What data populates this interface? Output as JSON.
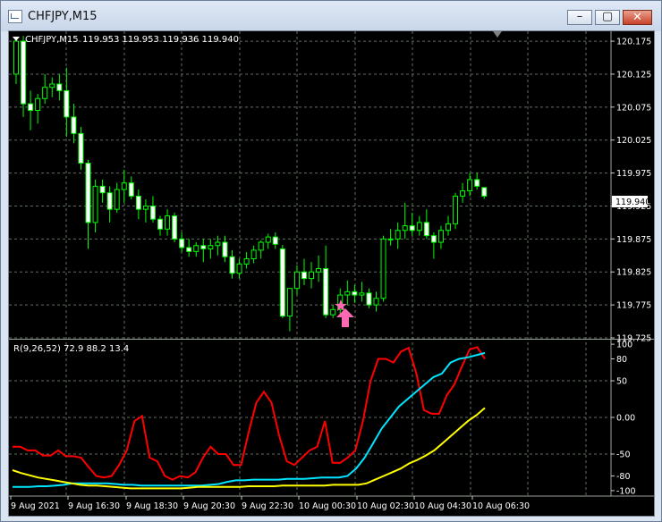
{
  "window": {
    "title": "CHFJPY,M15",
    "minimize_label": "–",
    "maximize_label": "▢",
    "close_label": "✕"
  },
  "main_chart": {
    "label": "CHFJPY,M15",
    "ohlc": "119.953 119.953 119.936 119.940",
    "price_levels": [
      "120.175",
      "120.125",
      "120.075",
      "120.025",
      "119.975",
      "119.925",
      "119.875",
      "119.825",
      "119.775",
      "119.725"
    ],
    "current_price": "119.940"
  },
  "indicator": {
    "label": "R(9,26,52) 72.9 88.2 13.4",
    "levels": [
      "100",
      "80",
      "50",
      "0.00",
      "-50",
      "-80",
      "-100"
    ]
  },
  "time_axis": [
    "9 Aug 2021",
    "9 Aug 16:30",
    "9 Aug 18:30",
    "9 Aug 20:30",
    "9 Aug 22:30",
    "10 Aug 00:30",
    "10 Aug 02:30",
    "10 Aug 04:30",
    "10 Aug 06:30"
  ],
  "colors": {
    "background": "#000000",
    "grid": "#5f6f5f",
    "candle": "#00ff00",
    "fast_line": "#ff0000",
    "mid_line": "#00e5ff",
    "slow_line": "#ffff00",
    "arrow": "#ff69b4"
  },
  "chart_data": [
    {
      "type": "candlestick",
      "title": "CHFJPY,M15",
      "ylim": [
        119.725,
        120.19
      ],
      "values": [
        {
          "o": 120.125,
          "h": 120.178,
          "l": 120.11,
          "c": 120.175
        },
        {
          "o": 120.175,
          "h": 120.183,
          "l": 120.06,
          "c": 120.08
        },
        {
          "o": 120.08,
          "h": 120.1,
          "l": 120.04,
          "c": 120.07
        },
        {
          "o": 120.07,
          "h": 120.095,
          "l": 120.05,
          "c": 120.088
        },
        {
          "o": 120.088,
          "h": 120.125,
          "l": 120.08,
          "c": 120.105
        },
        {
          "o": 120.105,
          "h": 120.12,
          "l": 120.09,
          "c": 120.11
        },
        {
          "o": 120.11,
          "h": 120.125,
          "l": 120.085,
          "c": 120.1
        },
        {
          "o": 120.1,
          "h": 120.135,
          "l": 120.03,
          "c": 120.06
        },
        {
          "o": 120.06,
          "h": 120.08,
          "l": 120.02,
          "c": 120.035
        },
        {
          "o": 120.035,
          "h": 120.045,
          "l": 119.98,
          "c": 119.99
        },
        {
          "o": 119.99,
          "h": 119.995,
          "l": 119.86,
          "c": 119.9
        },
        {
          "o": 119.9,
          "h": 119.965,
          "l": 119.885,
          "c": 119.955
        },
        {
          "o": 119.955,
          "h": 119.965,
          "l": 119.93,
          "c": 119.945
        },
        {
          "o": 119.945,
          "h": 119.955,
          "l": 119.9,
          "c": 119.92
        },
        {
          "o": 119.92,
          "h": 119.96,
          "l": 119.915,
          "c": 119.95
        },
        {
          "o": 119.95,
          "h": 119.98,
          "l": 119.93,
          "c": 119.96
        },
        {
          "o": 119.96,
          "h": 119.97,
          "l": 119.935,
          "c": 119.94
        },
        {
          "o": 119.94,
          "h": 119.95,
          "l": 119.905,
          "c": 119.92
        },
        {
          "o": 119.92,
          "h": 119.935,
          "l": 119.9,
          "c": 119.925
        },
        {
          "o": 119.925,
          "h": 119.94,
          "l": 119.9,
          "c": 119.905
        },
        {
          "o": 119.905,
          "h": 119.91,
          "l": 119.88,
          "c": 119.89
        },
        {
          "o": 119.89,
          "h": 119.92,
          "l": 119.88,
          "c": 119.91
        },
        {
          "o": 119.91,
          "h": 119.915,
          "l": 119.87,
          "c": 119.875
        },
        {
          "o": 119.875,
          "h": 119.885,
          "l": 119.855,
          "c": 119.862
        },
        {
          "o": 119.862,
          "h": 119.875,
          "l": 119.848,
          "c": 119.856
        },
        {
          "o": 119.856,
          "h": 119.87,
          "l": 119.848,
          "c": 119.865
        },
        {
          "o": 119.865,
          "h": 119.875,
          "l": 119.84,
          "c": 119.86
        },
        {
          "o": 119.86,
          "h": 119.875,
          "l": 119.845,
          "c": 119.865
        },
        {
          "o": 119.865,
          "h": 119.88,
          "l": 119.85,
          "c": 119.87
        },
        {
          "o": 119.87,
          "h": 119.88,
          "l": 119.84,
          "c": 119.848
        },
        {
          "o": 119.848,
          "h": 119.858,
          "l": 119.815,
          "c": 119.823
        },
        {
          "o": 119.823,
          "h": 119.845,
          "l": 119.815,
          "c": 119.837
        },
        {
          "o": 119.837,
          "h": 119.855,
          "l": 119.83,
          "c": 119.845
        },
        {
          "o": 119.845,
          "h": 119.865,
          "l": 119.838,
          "c": 119.858
        },
        {
          "o": 119.858,
          "h": 119.873,
          "l": 119.845,
          "c": 119.87
        },
        {
          "o": 119.87,
          "h": 119.883,
          "l": 119.86,
          "c": 119.878
        },
        {
          "o": 119.878,
          "h": 119.885,
          "l": 119.86,
          "c": 119.867
        },
        {
          "o": 119.86,
          "h": 119.866,
          "l": 119.755,
          "c": 119.758
        },
        {
          "o": 119.758,
          "h": 119.8,
          "l": 119.735,
          "c": 119.8
        },
        {
          "o": 119.8,
          "h": 119.835,
          "l": 119.79,
          "c": 119.825
        },
        {
          "o": 119.825,
          "h": 119.845,
          "l": 119.805,
          "c": 119.815
        },
        {
          "o": 119.815,
          "h": 119.84,
          "l": 119.8,
          "c": 119.825
        },
        {
          "o": 119.825,
          "h": 119.85,
          "l": 119.81,
          "c": 119.83
        },
        {
          "o": 119.83,
          "h": 119.865,
          "l": 119.755,
          "c": 119.76
        },
        {
          "o": 119.76,
          "h": 119.775,
          "l": 119.755,
          "c": 119.768
        },
        {
          "o": 119.768,
          "h": 119.8,
          "l": 119.76,
          "c": 119.79
        },
        {
          "o": 119.79,
          "h": 119.812,
          "l": 119.775,
          "c": 119.795
        },
        {
          "o": 119.795,
          "h": 119.805,
          "l": 119.778,
          "c": 119.79
        },
        {
          "o": 119.79,
          "h": 119.81,
          "l": 119.78,
          "c": 119.793
        },
        {
          "o": 119.793,
          "h": 119.8,
          "l": 119.77,
          "c": 119.775
        },
        {
          "o": 119.775,
          "h": 119.795,
          "l": 119.765,
          "c": 119.785
        },
        {
          "o": 119.785,
          "h": 119.88,
          "l": 119.78,
          "c": 119.875
        },
        {
          "o": 119.875,
          "h": 119.89,
          "l": 119.865,
          "c": 119.875
        },
        {
          "o": 119.875,
          "h": 119.9,
          "l": 119.86,
          "c": 119.888
        },
        {
          "o": 119.888,
          "h": 119.93,
          "l": 119.875,
          "c": 119.895
        },
        {
          "o": 119.895,
          "h": 119.915,
          "l": 119.88,
          "c": 119.888
        },
        {
          "o": 119.888,
          "h": 119.91,
          "l": 119.88,
          "c": 119.9
        },
        {
          "o": 119.9,
          "h": 119.92,
          "l": 119.875,
          "c": 119.88
        },
        {
          "o": 119.88,
          "h": 119.885,
          "l": 119.845,
          "c": 119.87
        },
        {
          "o": 119.87,
          "h": 119.895,
          "l": 119.86,
          "c": 119.888
        },
        {
          "o": 119.888,
          "h": 119.91,
          "l": 119.88,
          "c": 119.898
        },
        {
          "o": 119.898,
          "h": 119.945,
          "l": 119.89,
          "c": 119.94
        },
        {
          "o": 119.94,
          "h": 119.96,
          "l": 119.93,
          "c": 119.948
        },
        {
          "o": 119.948,
          "h": 119.975,
          "l": 119.94,
          "c": 119.965
        },
        {
          "o": 119.965,
          "h": 119.975,
          "l": 119.95,
          "c": 119.955
        },
        {
          "o": 119.953,
          "h": 119.953,
          "l": 119.936,
          "c": 119.94
        }
      ]
    },
    {
      "type": "line",
      "title": "R(9,26,52)",
      "ylim": [
        -105,
        105
      ],
      "series": [
        {
          "name": "R(9)",
          "values": [
            -40,
            -40,
            -45,
            -45,
            -52,
            -52,
            -45,
            -53,
            -53,
            -55,
            -68,
            -80,
            -82,
            -80,
            -65,
            -45,
            -5,
            2,
            -55,
            -60,
            -80,
            -85,
            -80,
            -82,
            -75,
            -55,
            -40,
            -50,
            -50,
            -65,
            -65,
            -20,
            20,
            35,
            20,
            -25,
            -60,
            -65,
            -55,
            -45,
            -40,
            -5,
            -62,
            -62,
            -55,
            -45,
            -5,
            50,
            80,
            80,
            75,
            90,
            95,
            60,
            10,
            5,
            5,
            30,
            45,
            70,
            93,
            96,
            80
          ]
        },
        {
          "name": "R(26)",
          "values": [
            -95,
            -95,
            -95,
            -94,
            -94,
            -93,
            -92,
            -90,
            -90,
            -90,
            -90,
            -90,
            -91,
            -92,
            -92,
            -93,
            -93,
            -93,
            -93,
            -93,
            -93,
            -93,
            -93,
            -92,
            -91,
            -88,
            -86,
            -86,
            -85,
            -85,
            -85,
            -85,
            -84,
            -84,
            -84,
            -83,
            -82,
            -82,
            -82,
            -80,
            -70,
            -55,
            -35,
            -15,
            0,
            15,
            25,
            35,
            45,
            55,
            60,
            75,
            80,
            82,
            85,
            88
          ]
        },
        {
          "name": "R(52)",
          "values": [
            -72,
            -76,
            -79,
            -82,
            -84,
            -86,
            -88,
            -90,
            -92,
            -93,
            -93,
            -94,
            -95,
            -96,
            -97,
            -97,
            -97,
            -97,
            -97,
            -97,
            -97,
            -96,
            -95,
            -95,
            -95,
            -95,
            -95,
            -95,
            -94,
            -94,
            -94,
            -94,
            -93,
            -93,
            -93,
            -93,
            -93,
            -93,
            -92,
            -92,
            -92,
            -92,
            -90,
            -85,
            -80,
            -75,
            -70,
            -63,
            -58,
            -52,
            -45,
            -35,
            -25,
            -15,
            -5,
            3,
            13
          ]
        }
      ]
    }
  ]
}
